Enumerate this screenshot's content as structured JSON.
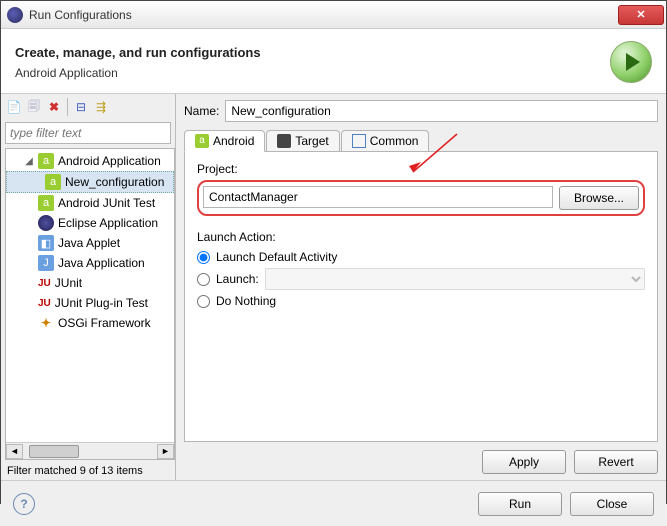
{
  "window_title": "Run Configurations",
  "header": {
    "title": "Create, manage, and run configurations",
    "subtitle": "Android Application"
  },
  "filter_placeholder": "type filter text",
  "tree": {
    "items": [
      {
        "label": "Android Application",
        "expanded": true
      },
      {
        "label": "New_configuration",
        "selected": true
      },
      {
        "label": "Android JUnit Test"
      },
      {
        "label": "Eclipse Application"
      },
      {
        "label": "Java Applet"
      },
      {
        "label": "Java Application"
      },
      {
        "label": "JUnit"
      },
      {
        "label": "JUnit Plug-in Test"
      },
      {
        "label": "OSGi Framework"
      }
    ]
  },
  "filter_status": "Filter matched 9 of 13 items",
  "form": {
    "name_label": "Name:",
    "name_value": "New_configuration",
    "tabs": [
      "Android",
      "Target",
      "Common"
    ],
    "project_label": "Project:",
    "project_value": "ContactManager",
    "browse_label": "Browse...",
    "launch_action_label": "Launch Action:",
    "radio_default": "Launch Default Activity",
    "radio_launch": "Launch:",
    "radio_nothing": "Do Nothing",
    "apply_label": "Apply",
    "revert_label": "Revert"
  },
  "footer": {
    "run_label": "Run",
    "close_label": "Close"
  }
}
